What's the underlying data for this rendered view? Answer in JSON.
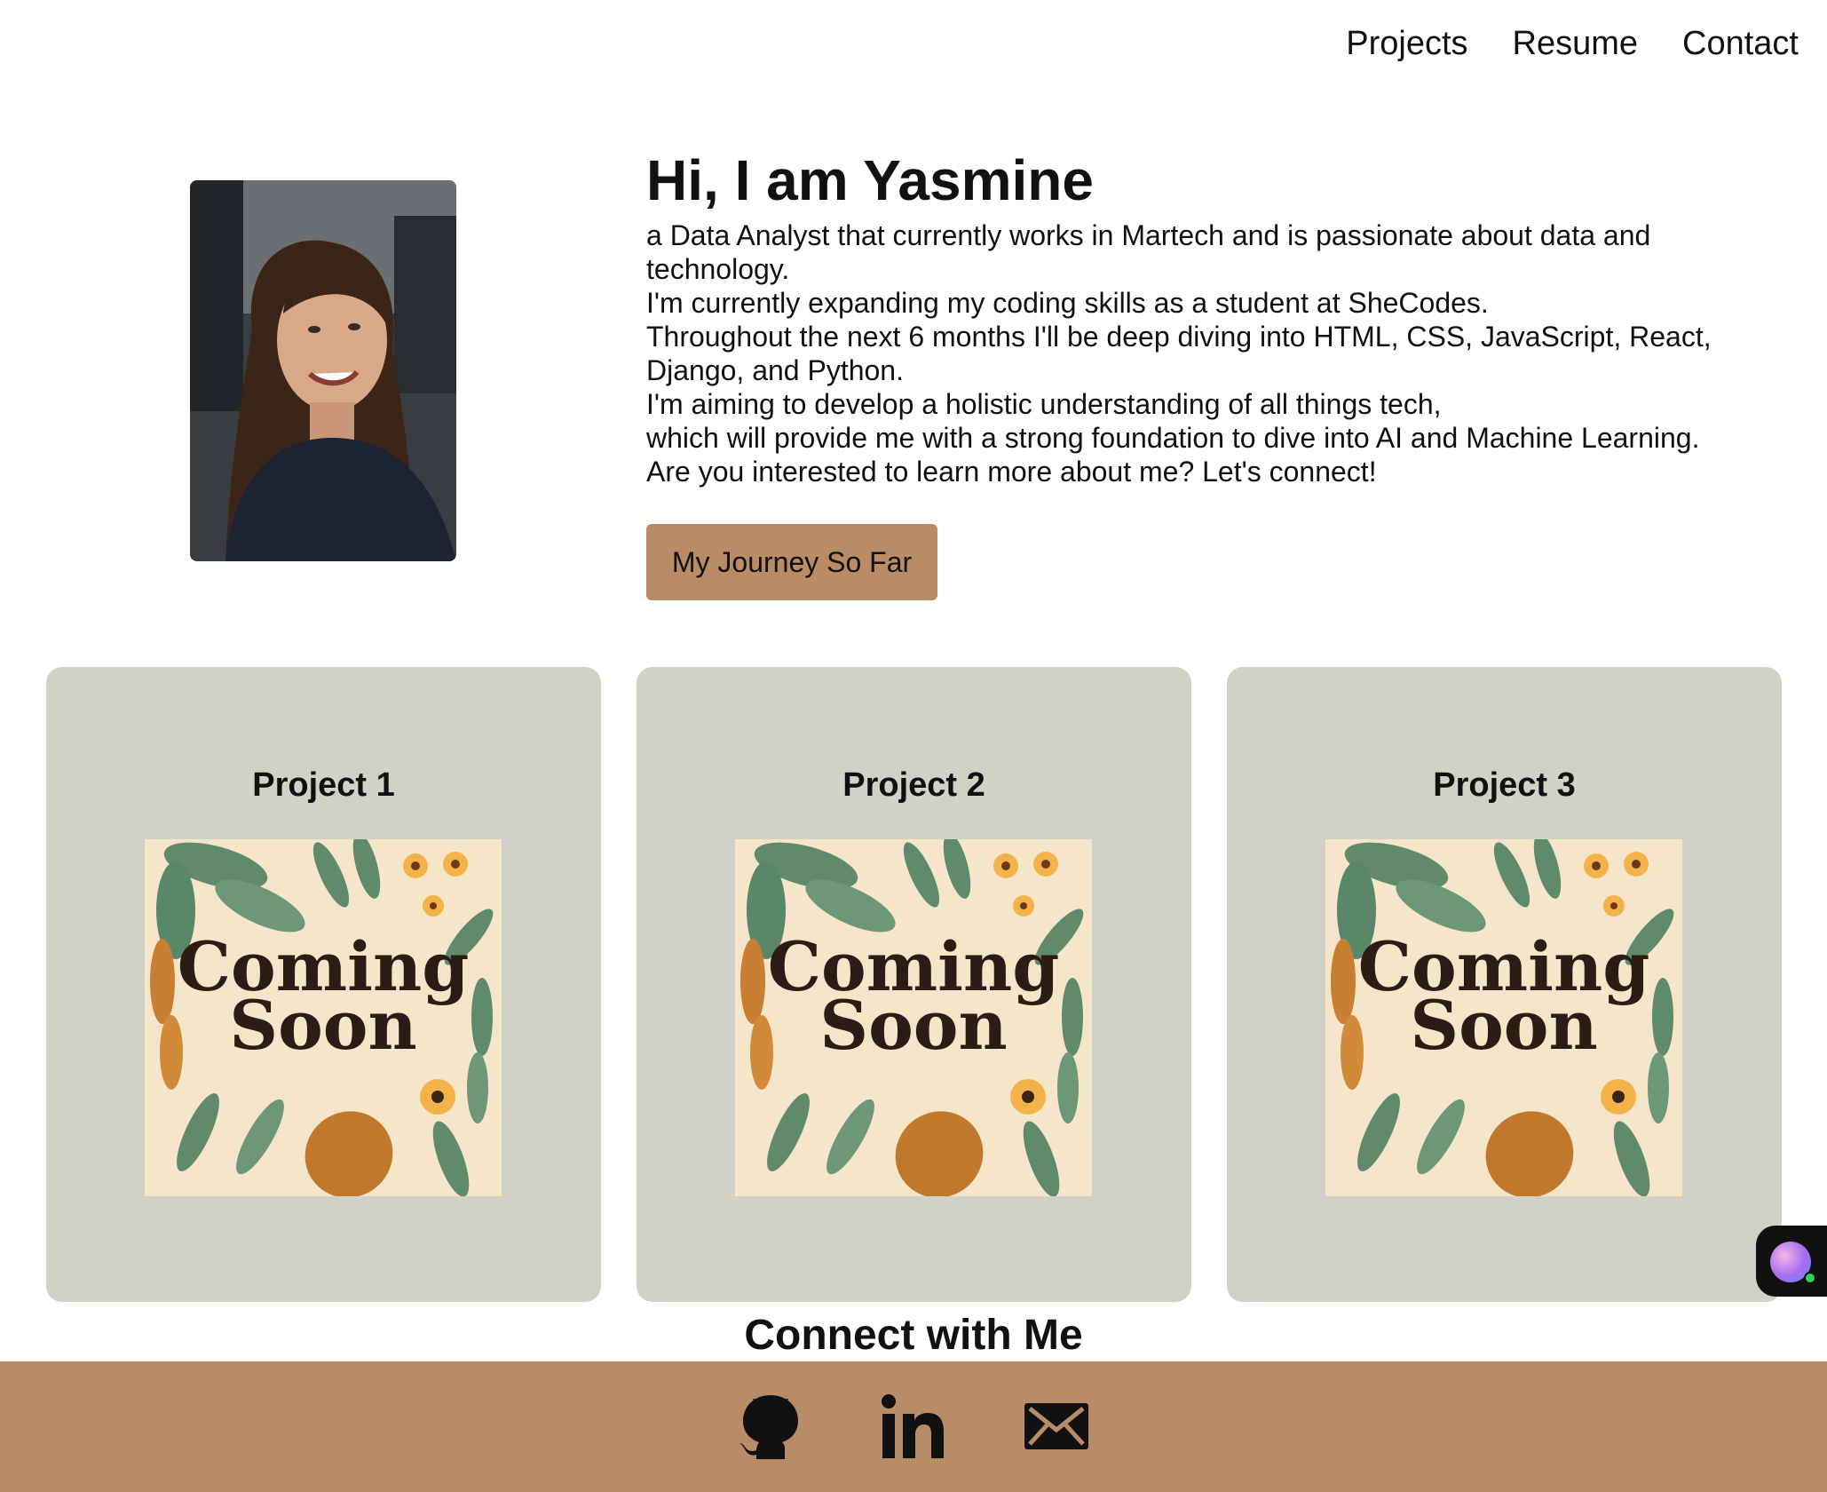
{
  "nav": {
    "items": [
      {
        "label": "Projects"
      },
      {
        "label": "Resume"
      },
      {
        "label": "Contact"
      }
    ]
  },
  "hero": {
    "title": "Hi, I am Yasmine",
    "bio_lines": [
      "a Data Analyst that currently works in Martech and is passionate about data and technology.",
      "I'm currently expanding my coding skills as a student at SheCodes.",
      "Throughout the next 6 months I'll be deep diving into HTML, CSS, JavaScript, React, Django, and Python.",
      "I'm aiming to develop a holistic understanding of all things tech,",
      "which will provide me with a strong foundation to dive into AI and Machine Learning.",
      "Are you interested to learn more about me? Let's connect!"
    ],
    "button_label": "My Journey So Far"
  },
  "projects": [
    {
      "title": "Project 1",
      "art_line1": "Coming",
      "art_line2": "Soon"
    },
    {
      "title": "Project 2",
      "art_line1": "Coming",
      "art_line2": "Soon"
    },
    {
      "title": "Project 3",
      "art_line1": "Coming",
      "art_line2": "Soon"
    }
  ],
  "connect": {
    "title": "Connect with Me",
    "icons": [
      "github-icon",
      "linkedin-icon",
      "mail-icon"
    ]
  },
  "colors": {
    "accent": "#b98c66",
    "card_bg": "#d2d1c6",
    "art_bg": "#f6e6c9"
  }
}
